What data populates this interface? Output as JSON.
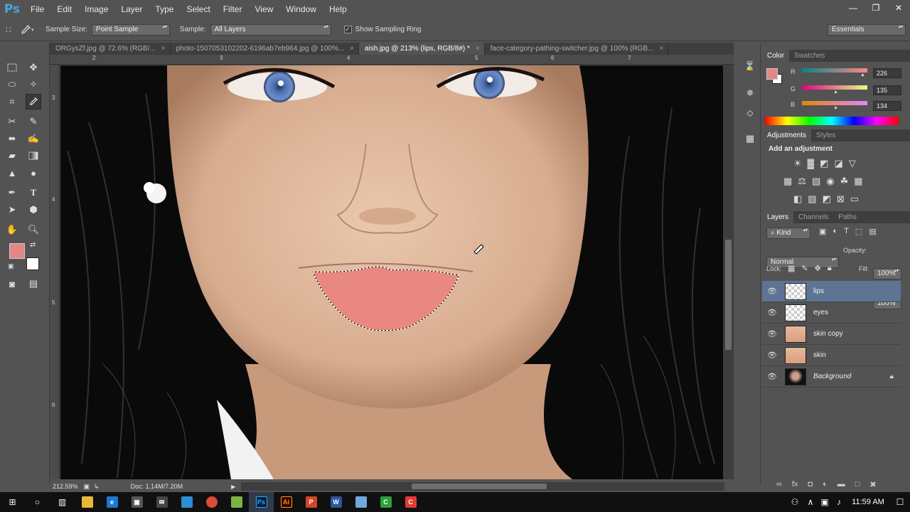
{
  "app": {
    "logo": "Ps"
  },
  "menu": [
    "File",
    "Edit",
    "Image",
    "Layer",
    "Type",
    "Select",
    "Filter",
    "View",
    "Window",
    "Help"
  ],
  "window_controls": {
    "minimize": "minimize-icon",
    "restore": "restore-icon",
    "close": "close-icon"
  },
  "options": {
    "sample_size_label": "Sample Size:",
    "sample_size_value": "Point Sample",
    "sample_label": "Sample:",
    "sample_value": "All Layers",
    "show_ring_label": "Show Sampling Ring",
    "show_ring_checked": true,
    "workspace": "Essentials"
  },
  "tabs": [
    {
      "label": "ORGysZf.jpg @ 72.6% (RGB/...",
      "close": "×"
    },
    {
      "label": "photo-1507053102202-6196ab7eb964.jpg @ 100%...",
      "close": "×"
    },
    {
      "label": "aish.jpg @ 213% (lips, RGB/8#) *",
      "close": "×",
      "active": true
    },
    {
      "label": "face-category-pathing-switcher.jpg @ 100% (RGB...",
      "close": "×"
    }
  ],
  "rulers": {
    "h": [
      "2",
      "3",
      "4",
      "5",
      "6",
      "7"
    ],
    "v": [
      "3",
      "4",
      "5",
      "6"
    ]
  },
  "status": {
    "zoom": "212.59%",
    "doc": "Doc: 1.14M/7.20M"
  },
  "color_panel": {
    "tabs": [
      "Color",
      "Swatches"
    ],
    "r_label": "R",
    "r_value": "226",
    "g_label": "G",
    "g_value": "135",
    "b_label": "B",
    "b_value": "134",
    "foreground": "#e28786",
    "background": "#ffffff"
  },
  "adjustments": {
    "tabs": [
      "Adjustments",
      "Styles"
    ],
    "heading": "Add an adjustment"
  },
  "layers_panel": {
    "tabs": [
      "Layers",
      "Channels",
      "Paths"
    ],
    "kind_label": "Kind",
    "blend_mode": "Normal",
    "opacity_label": "Opacity:",
    "opacity_value": "100%",
    "lock_label": "Lock:",
    "fill_label": "Fill:",
    "fill_value": "100%",
    "layers": [
      {
        "name": "lips",
        "selected": true
      },
      {
        "name": "eyes"
      },
      {
        "name": "skin copy"
      },
      {
        "name": "skin"
      },
      {
        "name": "Background",
        "locked": true
      }
    ]
  },
  "taskbar": {
    "time": "11:59 AM"
  }
}
